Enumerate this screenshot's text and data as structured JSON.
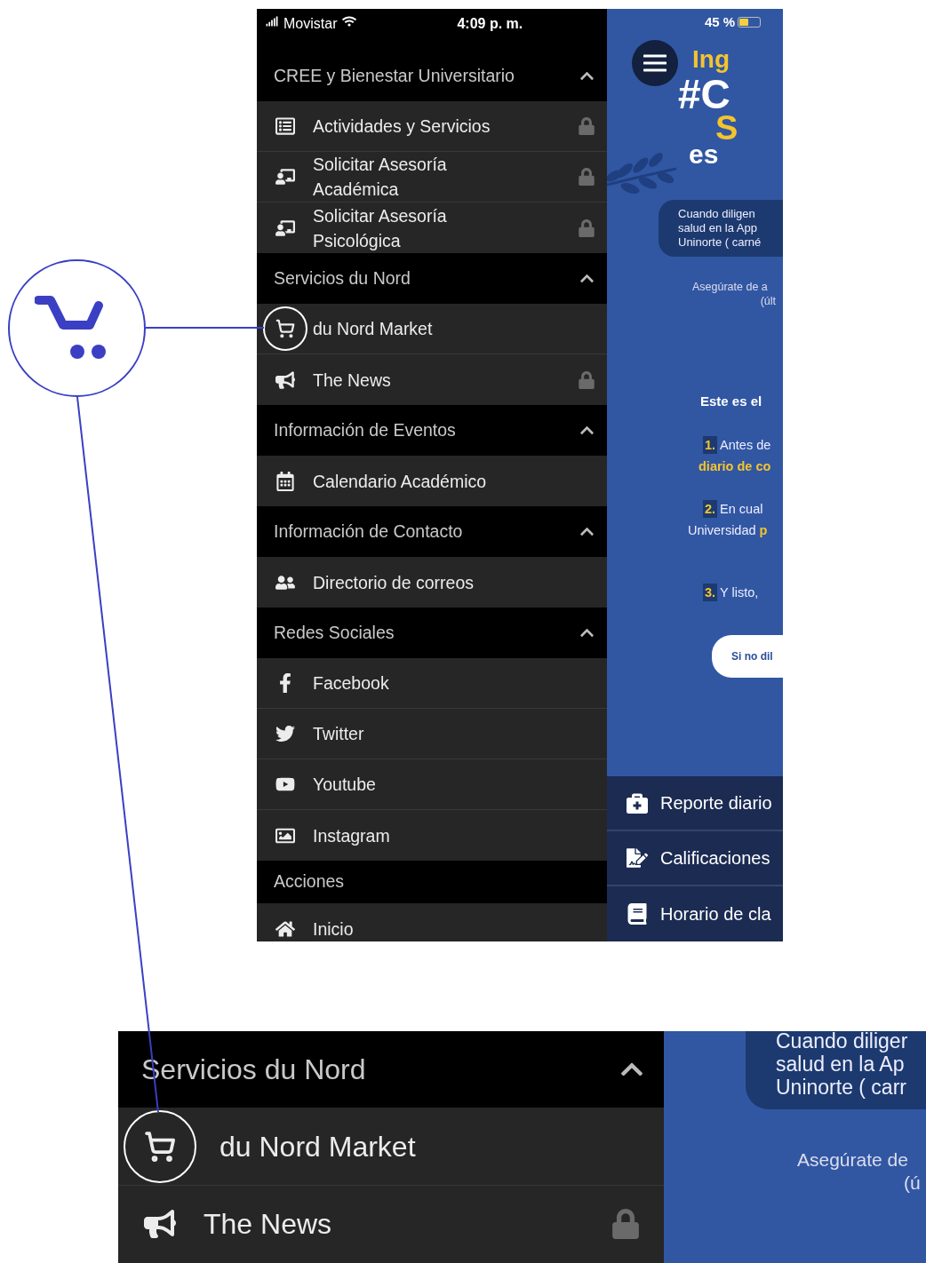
{
  "status_bar": {
    "carrier": "Movistar",
    "time": "4:09 p. m.",
    "battery": "45 %"
  },
  "drawer": {
    "sections": [
      {
        "title": "CREE y Bienestar Universitario",
        "collapsible": true,
        "items": [
          {
            "label": "Actividades y Servicios",
            "kind": "list",
            "locked": true,
            "highlighted": false
          },
          {
            "label": "Solicitar Asesoría Académica",
            "kind": "advice",
            "locked": true,
            "highlighted": false
          },
          {
            "label": "Solicitar Asesoría Psicológica",
            "kind": "advice",
            "locked": true,
            "highlighted": false
          }
        ]
      },
      {
        "title": "Servicios du Nord",
        "collapsible": true,
        "items": [
          {
            "label": "du Nord Market",
            "kind": "cart",
            "locked": false,
            "highlighted": true
          },
          {
            "label": "The News",
            "kind": "megaphone",
            "locked": true,
            "highlighted": false
          }
        ]
      },
      {
        "title": "Información de Eventos",
        "collapsible": true,
        "items": [
          {
            "label": "Calendario Académico",
            "kind": "calendar",
            "locked": false,
            "highlighted": false
          }
        ]
      },
      {
        "title": "Información de Contacto",
        "collapsible": true,
        "items": [
          {
            "label": "Directorio de correos",
            "kind": "users",
            "locked": false,
            "highlighted": false
          }
        ]
      },
      {
        "title": "Redes Sociales",
        "collapsible": true,
        "items": [
          {
            "label": "Facebook",
            "kind": "facebook",
            "locked": false,
            "highlighted": false
          },
          {
            "label": "Twitter",
            "kind": "twitter",
            "locked": false,
            "highlighted": false
          },
          {
            "label": "Youtube",
            "kind": "youtube",
            "locked": false,
            "highlighted": false
          },
          {
            "label": "Instagram",
            "kind": "image",
            "locked": false,
            "highlighted": false
          }
        ]
      },
      {
        "title": "Acciones",
        "collapsible": false,
        "items": [
          {
            "label": "Inicio",
            "kind": "home",
            "locked": false,
            "highlighted": false
          }
        ]
      }
    ]
  },
  "content": {
    "headline": [
      {
        "text": "Ing",
        "accent": true
      },
      {
        "text": "#C",
        "accent": false
      },
      {
        "text": "S",
        "accent": true
      },
      {
        "text": "es",
        "accent": false
      }
    ],
    "pill_lines": [
      "Cuando diligen",
      "salud en la App",
      "Uninorte ( carné"
    ],
    "note_lines": [
      "Asegúrate de a",
      "(últ"
    ],
    "intro": "Este es el",
    "steps": [
      {
        "number": "1.",
        "lines": [
          [
            {
              "text": "Antes de",
              "accent": false
            }
          ],
          [
            {
              "text": "diario de co",
              "accent": true
            }
          ]
        ]
      },
      {
        "number": "2.",
        "lines": [
          [
            {
              "text": "En cual",
              "accent": false
            }
          ],
          [
            {
              "text": "Universidad ",
              "accent": false
            },
            {
              "text": "p",
              "accent": true
            }
          ]
        ]
      },
      {
        "number": "3.",
        "lines": [
          [
            {
              "text": "Y listo,",
              "accent": false
            }
          ]
        ]
      }
    ],
    "button": "Si no dil"
  },
  "bottom_menu": [
    {
      "label": "Reporte diario",
      "kind": "medkit"
    },
    {
      "label": "Calificaciones",
      "kind": "certificate"
    },
    {
      "label": "Horario de cla",
      "kind": "book"
    }
  ],
  "zoom_view": {
    "section_title": "Servicios du Nord",
    "collapsible": true,
    "items": [
      {
        "label": "du Nord Market",
        "kind": "cart",
        "locked": false,
        "highlighted": true
      },
      {
        "label": "The News",
        "kind": "megaphone",
        "locked": true,
        "highlighted": false
      }
    ],
    "pill_lines": [
      "Cuando diliger",
      "salud en la Ap",
      "Uninorte ( carr"
    ],
    "note_lines": [
      "Asegúrate de",
      "(ú"
    ]
  }
}
